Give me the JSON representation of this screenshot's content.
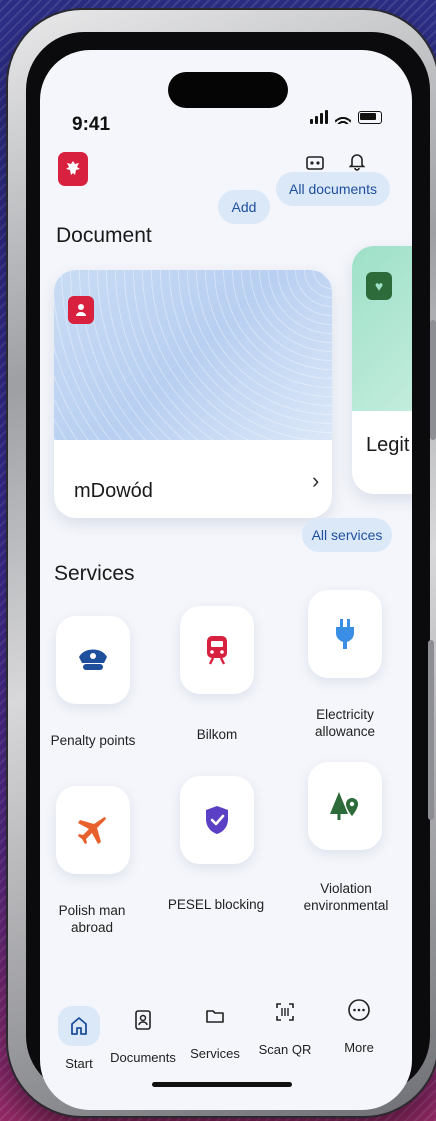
{
  "status": {
    "time": "9:41"
  },
  "header": {
    "add_label": "Add",
    "all_documents_label": "All documents"
  },
  "documents": {
    "title": "Document",
    "cards": [
      {
        "name": "mDowód"
      },
      {
        "name": "Legit"
      }
    ]
  },
  "services": {
    "title": "Services",
    "all_services_label": "All services",
    "items": [
      {
        "label": "Penalty points"
      },
      {
        "label": "Bilkom"
      },
      {
        "label": "Electricity allowance"
      },
      {
        "label": "Polish man abroad"
      },
      {
        "label": "PESEL blocking"
      },
      {
        "label": "Violation environmental"
      }
    ]
  },
  "nav": {
    "items": [
      {
        "label": "Start"
      },
      {
        "label": "Documents"
      },
      {
        "label": "Services"
      },
      {
        "label": "Scan QR"
      },
      {
        "label": "More"
      }
    ]
  },
  "colors": {
    "accent": "#1e4f9c",
    "brand_red": "#d8213f",
    "pill_bg": "#dbe8f8"
  }
}
